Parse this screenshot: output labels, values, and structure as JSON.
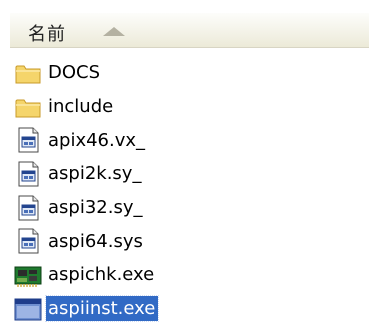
{
  "header": {
    "name_column": "名前",
    "sort_icon": "sort-ascending-icon"
  },
  "files": [
    {
      "name": "DOCS",
      "icon": "folder-icon",
      "selected": false
    },
    {
      "name": "include",
      "icon": "folder-icon",
      "selected": false
    },
    {
      "name": "apix46.vx_",
      "icon": "system-file-icon",
      "selected": false
    },
    {
      "name": "aspi2k.sy_",
      "icon": "system-file-icon",
      "selected": false
    },
    {
      "name": "aspi32.sy_",
      "icon": "system-file-icon",
      "selected": false
    },
    {
      "name": "aspi64.sys",
      "icon": "system-file-icon",
      "selected": false
    },
    {
      "name": "aspichk.exe",
      "icon": "circuit-board-icon",
      "selected": false
    },
    {
      "name": "aspiinst.exe",
      "icon": "application-window-icon",
      "selected": true
    }
  ],
  "colors": {
    "selection": "#316ac5",
    "folder": "#f5d56b"
  }
}
